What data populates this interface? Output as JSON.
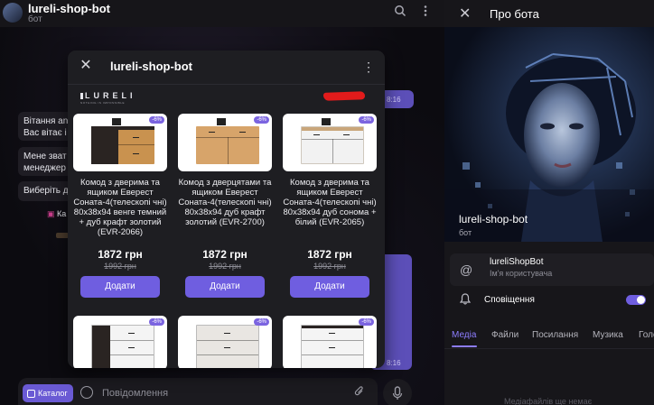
{
  "chat": {
    "title": "lureli-shop-bot",
    "subtitle": "бот",
    "messages": {
      "greeting_1a": "Вітання an",
      "greeting_1b": "Вас вітає і",
      "greeting_2a": "Мене зват",
      "greeting_2b": "менеджер",
      "greeting_3": "Виберіть д",
      "catalog_fragment": "Ка"
    },
    "times": [
      "8:16",
      "8:16"
    ],
    "composer": {
      "catalog_label": "Каталог",
      "placeholder": "Повідомлення"
    }
  },
  "popup": {
    "title": "lureli-shop-bot",
    "logo": "LURELI",
    "logo_tagline": "NOTHING IS IMPOSSIBLE",
    "products": [
      {
        "name": "Комод з дверима та ящиком Еверест Соната-4(телескопі чні) 80х38х94 венге темний + дуб крафт золотий (EVR-2066)",
        "price": "1872 грн",
        "old_price": "1992 грн",
        "discount": "-6%",
        "button": "Додати"
      },
      {
        "name": "Комод з дверцятами та ящиком Еверест Соната-4(телескопі чні) 80х38х94 дуб крафт золотий (EVR-2700)",
        "price": "1872 грн",
        "old_price": "1992 грн",
        "discount": "-6%",
        "button": "Додати"
      },
      {
        "name": "Комод з дверима та ящиком Еверест Соната-4(телескопі чні) 80х38х94 дуб сонома + білий (EVR-2065)",
        "price": "1872 грн",
        "old_price": "1992 грн",
        "discount": "-6%",
        "button": "Додати"
      }
    ],
    "row2_discounts": [
      "-6%",
      "-6%",
      "-6%"
    ]
  },
  "panel": {
    "title": "Про бота",
    "bot_name": "lureli-shop-bot",
    "bot_sub": "бот",
    "username": "lureliShopBot",
    "username_label": "Ім'я користувача",
    "notifications_label": "Сповіщення",
    "notifications_on": true,
    "tabs": [
      "Медіа",
      "Файли",
      "Посилання",
      "Музика",
      "Голо"
    ],
    "active_tab": "Медіа",
    "media_empty": "Медіафайлів ще немає"
  },
  "colors": {
    "accent": "#6f5ee0",
    "own_bubble": "#5c4fb8",
    "background": "#0c0b10"
  }
}
